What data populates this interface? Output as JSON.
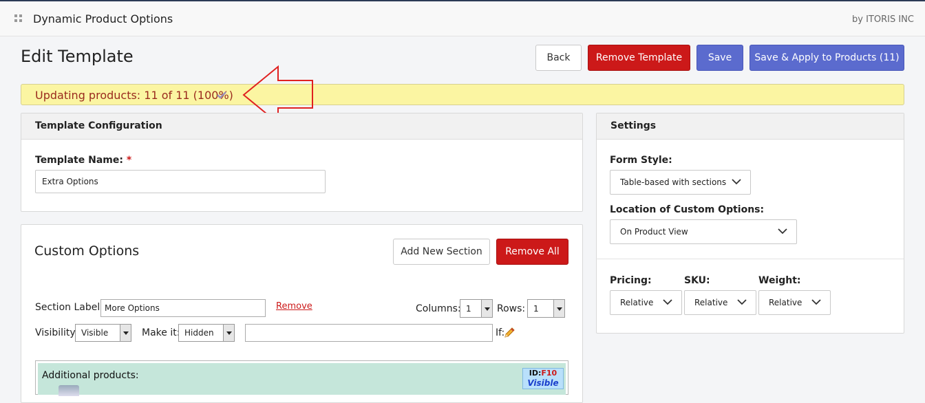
{
  "header": {
    "app_title": "Dynamic Product Options",
    "vendor": "by ITORIS INC",
    "icon": "grid-icon"
  },
  "page": {
    "title": "Edit Template"
  },
  "actions": {
    "back": "Back",
    "remove_template": "Remove Template",
    "save": "Save",
    "save_apply": "Save & Apply to Products (11)"
  },
  "notice": {
    "text": "Updating products: 11 of 11 (100%)",
    "icon": "check-icon",
    "color": "#9a2b1e"
  },
  "template_config": {
    "title": "Template Configuration",
    "name_label": "Template Name:",
    "required_mark": "*",
    "name_value": "Extra Options"
  },
  "settings": {
    "title": "Settings",
    "form_style_label": "Form Style:",
    "form_style_value": "Table-based with sections",
    "location_label": "Location of Custom Options:",
    "location_value": "On Product View",
    "pricing_label": "Pricing:",
    "pricing_value": "Relative",
    "sku_label": "SKU:",
    "sku_value": "Relative",
    "weight_label": "Weight:",
    "weight_value": "Relative"
  },
  "custom_options": {
    "title": "Custom Options",
    "add_section": "Add New Section",
    "remove_all": "Remove All",
    "section_label": "Section Label:",
    "section_value": "More Options",
    "remove_link": "Remove",
    "columns_label": "Columns:",
    "columns_value": "1",
    "rows_label": "Rows:",
    "rows_value": "1",
    "visibility_label": "Visibility:",
    "visibility_value": "Visible",
    "make_it_label": "Make it:",
    "make_it_value": "Hidden",
    "condition_value": "",
    "if_label": "If:",
    "grid": {
      "cell_label": "Additional products:",
      "id_label": "ID:",
      "id_value": "F10",
      "visibility": "Visible"
    }
  },
  "colors": {
    "accent_blue": "#5b6bce",
    "danger_red": "#cc1919",
    "notice_bg": "#fbf5a2",
    "annotation_arrow": "#e02020",
    "cell_bg": "#c5e6da",
    "badge_bg": "#b9e0fb"
  }
}
